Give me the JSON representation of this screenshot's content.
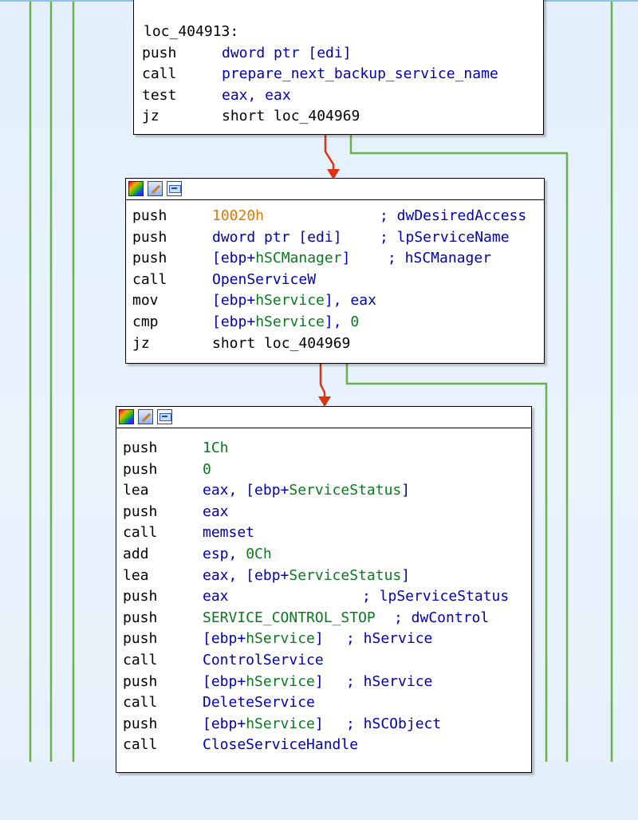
{
  "colors": {
    "background": "#e6f1fb",
    "edge_true": "#dd3311",
    "edge_false": "#6ab04c",
    "operand": "#0000b8",
    "immediate": "#e07a00",
    "symbol_green": "#0a7a20"
  },
  "header_icons": [
    "palette-icon",
    "edit-icon",
    "graph-icon"
  ],
  "blocks": [
    {
      "id": "loc_404913",
      "label": "loc_404913:",
      "lines": [
        {
          "mnemonic": "push",
          "operand": "dword ptr [edi]"
        },
        {
          "mnemonic": "call",
          "operand": "prepare_next_backup_service_name"
        },
        {
          "mnemonic": "test",
          "operand": "eax, eax"
        },
        {
          "mnemonic": "jz",
          "operand": "short loc_404969"
        }
      ]
    },
    {
      "id": "open_service_block",
      "lines": [
        {
          "mnemonic": "push",
          "operand_num": "10020h",
          "comment": "; dwDesiredAccess"
        },
        {
          "mnemonic": "push",
          "operand": "dword ptr [edi]",
          "comment": "; lpServiceName"
        },
        {
          "mnemonic": "push",
          "operand_pre": "[ebp+",
          "operand_sym": "hSCManager",
          "operand_post": "]",
          "comment": "; hSCManager"
        },
        {
          "mnemonic": "call",
          "operand": "OpenServiceW"
        },
        {
          "mnemonic": "mov",
          "operand_pre": "[ebp+",
          "operand_sym": "hService",
          "operand_post": "], eax"
        },
        {
          "mnemonic": "cmp",
          "operand_pre": "[ebp+",
          "operand_sym": "hService",
          "operand_post": "], ",
          "operand_num": "0"
        },
        {
          "mnemonic": "jz",
          "operand": "short loc_404969"
        }
      ]
    },
    {
      "id": "control_service_block",
      "lines": [
        {
          "mnemonic": "push",
          "operand_num": "1Ch"
        },
        {
          "mnemonic": "push",
          "operand_num": "0"
        },
        {
          "mnemonic": "lea",
          "operand_pre": "eax, [ebp+",
          "operand_sym": "ServiceStatus",
          "operand_post": "]"
        },
        {
          "mnemonic": "push",
          "operand": "eax"
        },
        {
          "mnemonic": "call",
          "operand": "memset"
        },
        {
          "mnemonic": "add",
          "operand_pre": "esp, ",
          "operand_num": "0Ch"
        },
        {
          "mnemonic": "lea",
          "operand_pre": "eax, [ebp+",
          "operand_sym": "ServiceStatus",
          "operand_post": "]"
        },
        {
          "mnemonic": "push",
          "operand": "eax",
          "comment": "; lpServiceStatus"
        },
        {
          "mnemonic": "push",
          "operand_sym": "SERVICE_CONTROL_STOP",
          "comment": "; dwControl"
        },
        {
          "mnemonic": "push",
          "operand_pre": "[ebp+",
          "operand_sym": "hService",
          "operand_post": "]",
          "comment": "; hService"
        },
        {
          "mnemonic": "call",
          "operand": "ControlService"
        },
        {
          "mnemonic": "push",
          "operand_pre": "[ebp+",
          "operand_sym": "hService",
          "operand_post": "]",
          "comment": "; hService"
        },
        {
          "mnemonic": "call",
          "operand": "DeleteService"
        },
        {
          "mnemonic": "push",
          "operand_pre": "[ebp+",
          "operand_sym": "hService",
          "operand_post": "]",
          "comment": "; hSCObject"
        },
        {
          "mnemonic": "call",
          "operand": "CloseServiceHandle"
        }
      ]
    }
  ]
}
